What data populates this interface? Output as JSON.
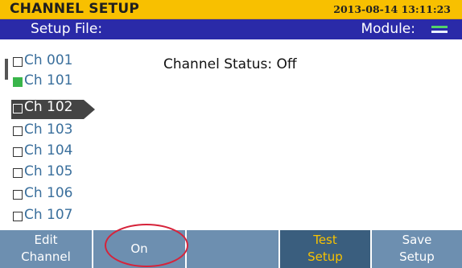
{
  "title_bar": {
    "title": "CHANNEL SETUP",
    "datetime": "2013-08-14 13:11:23"
  },
  "header": {
    "setup_label": "Setup File:",
    "module_label": "Module:",
    "module_icon": "module-bars-icon"
  },
  "channels": [
    {
      "label": "Ch 001",
      "checked": false,
      "selected": false
    },
    {
      "label": "Ch 101",
      "checked": true,
      "selected": false
    },
    {
      "label": "Ch 102",
      "checked": false,
      "selected": true
    },
    {
      "label": "Ch 103",
      "checked": false,
      "selected": false
    },
    {
      "label": "Ch 104",
      "checked": false,
      "selected": false
    },
    {
      "label": "Ch 105",
      "checked": false,
      "selected": false
    },
    {
      "label": "Ch 106",
      "checked": false,
      "selected": false
    },
    {
      "label": "Ch 107",
      "checked": false,
      "selected": false
    }
  ],
  "status": {
    "text": "Channel Status: Off"
  },
  "softkeys": [
    {
      "line1": "Edit",
      "line2": "Channel"
    },
    {
      "line1": "On"
    },
    {
      "line1": ""
    },
    {
      "line1": "Test",
      "line2": "Setup"
    },
    {
      "line1": "Save",
      "line2": "Setup"
    }
  ],
  "colors": {
    "title_bg": "#f8c000",
    "header_bg": "#2a2aa8",
    "softkey_bg": "#6d8fb0",
    "softkey_active_bg": "#3a5e7e",
    "softkey_active_text": "#f8c200",
    "checked_box": "#39b54a",
    "channel_text": "#3a6f9c",
    "highlight_ring": "#d6233a"
  }
}
